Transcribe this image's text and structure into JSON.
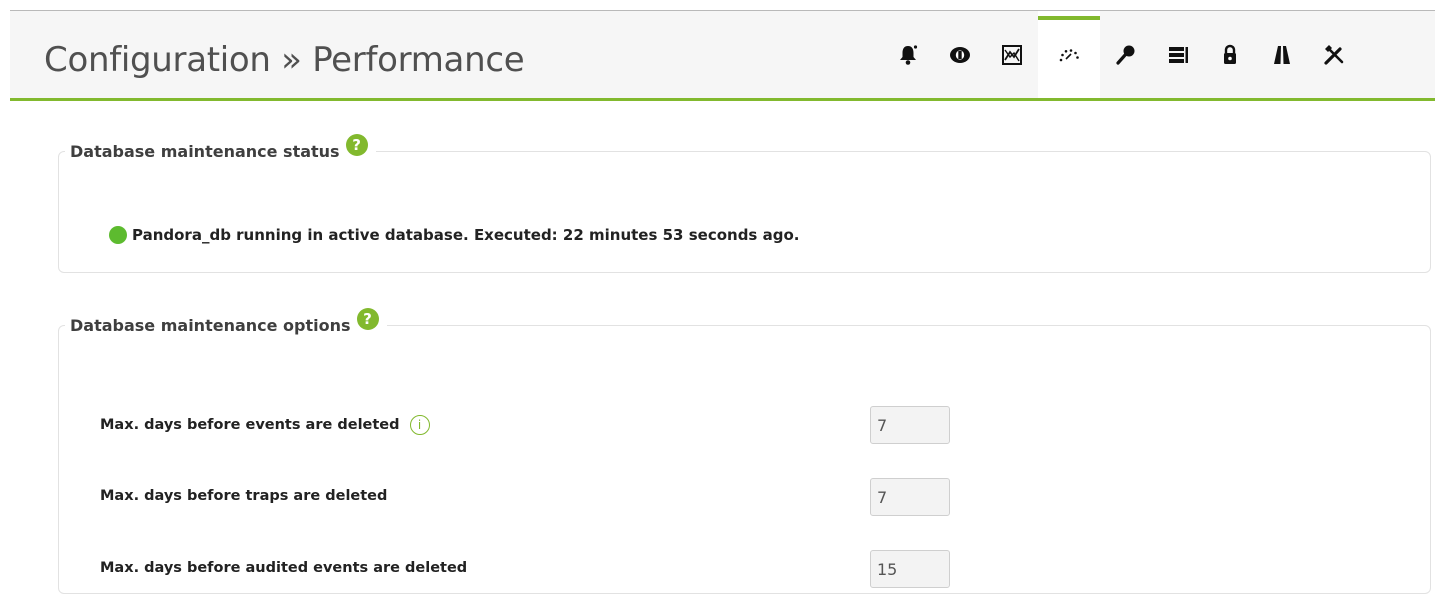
{
  "header": {
    "title": "Configuration » Performance",
    "tabs": [
      {
        "icon": "bell-icon",
        "active": false
      },
      {
        "icon": "eye-icon",
        "active": false
      },
      {
        "icon": "chart-icon",
        "active": false
      },
      {
        "icon": "gauge-icon",
        "active": true
      },
      {
        "icon": "key-icon",
        "active": false
      },
      {
        "icon": "list-icon",
        "active": false
      },
      {
        "icon": "lock-icon",
        "active": false
      },
      {
        "icon": "road-icon",
        "active": false
      },
      {
        "icon": "tools-icon",
        "active": false
      }
    ]
  },
  "status_section": {
    "legend": "Database maintenance status",
    "help_glyph": "?",
    "status_text": "Pandora_db running in active database. Executed: 22 minutes 53 seconds ago.",
    "status_color": "#5dbb2f"
  },
  "options_section": {
    "legend": "Database maintenance options",
    "help_glyph": "?",
    "info_glyph": "i",
    "fields": [
      {
        "label": "Max. days before events are deleted",
        "value": "7"
      },
      {
        "label": "Max. days before traps are deleted",
        "value": "7"
      },
      {
        "label": "Max. days before audited events are deleted",
        "value": "15"
      }
    ]
  },
  "colors": {
    "accent": "#82b92e",
    "header_bg": "#f6f6f6"
  }
}
